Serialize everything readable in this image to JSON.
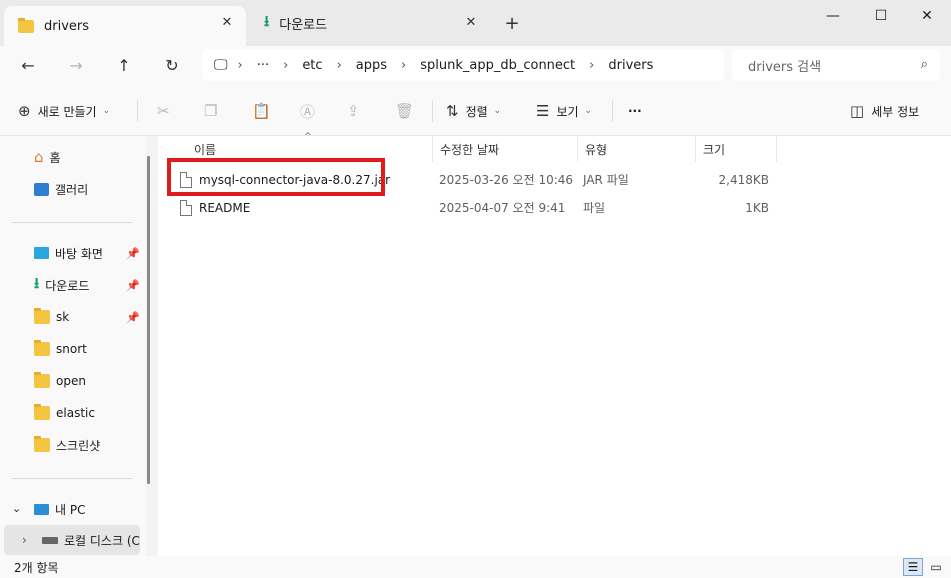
{
  "window": {
    "tabs": [
      {
        "label": "drivers",
        "active": true
      },
      {
        "label": "다운로드",
        "active": false
      }
    ],
    "new_tab": "+",
    "controls": {
      "minimize": "—",
      "maximize": "☐",
      "close": "✕"
    }
  },
  "navigation": {
    "back": "←",
    "forward": "→",
    "up": "↑",
    "refresh": "↻",
    "breadcrumb": [
      "etc",
      "apps",
      "splunk_app_db_connect",
      "drivers"
    ],
    "overflow": "···",
    "search_placeholder": "drivers 검색"
  },
  "commandbar": {
    "new_label": "새로 만들기",
    "sort_label": "정렬",
    "view_label": "보기",
    "more": "···",
    "details_label": "세부 정보"
  },
  "sidebar": {
    "quick": [
      {
        "label": "홈",
        "icon": "home-icon"
      },
      {
        "label": "갤러리",
        "icon": "gallery-icon"
      }
    ],
    "pinned": [
      {
        "label": "바탕 화면",
        "icon": "desktop-icon",
        "pinned": true
      },
      {
        "label": "다운로드",
        "icon": "download-icon",
        "pinned": true
      },
      {
        "label": "sk",
        "icon": "folder-icon",
        "pinned": true
      },
      {
        "label": "snort",
        "icon": "folder-icon",
        "pinned": false
      },
      {
        "label": "open",
        "icon": "folder-icon",
        "pinned": false
      },
      {
        "label": "elastic",
        "icon": "folder-icon",
        "pinned": false
      },
      {
        "label": "스크린샷",
        "icon": "folder-icon",
        "pinned": false
      }
    ],
    "thispc": {
      "label": "내 PC"
    },
    "localdisk": {
      "label": "로컬 디스크 (C"
    }
  },
  "filelist": {
    "columns": [
      "이름",
      "수정한 날짜",
      "유형",
      "크기"
    ],
    "rows": [
      {
        "name": "mysql-connector-java-8.0.27.jar",
        "modified": "2025-03-26 오전 10:46",
        "type": "JAR 파일",
        "size": "2,418KB"
      },
      {
        "name": "README",
        "modified": "2025-04-07 오전 9:41",
        "type": "파일",
        "size": "1KB"
      }
    ]
  },
  "status": {
    "item_count": "2개 항목"
  },
  "colors": {
    "highlight": "#e01b1b",
    "folder": "#f4c542",
    "accent": "#0067c0"
  }
}
